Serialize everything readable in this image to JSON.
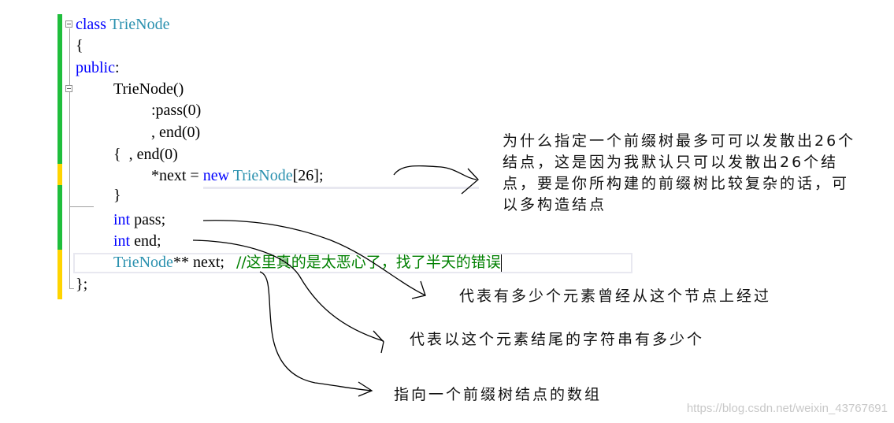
{
  "editor": {
    "gutter_colors": {
      "saved": "#1fbe3c",
      "modified": "#ffd400"
    },
    "code_lines": [
      {
        "text_kw": "class",
        "text_type": "TrieNode"
      },
      {
        "text": "{"
      },
      {
        "text_kw": "public",
        "text": ":"
      },
      {
        "text": "TrieNode()"
      },
      {
        "text": ":pass(0)"
      },
      {
        "text": ", end(0)"
      },
      {
        "text": "{  , end(0)"
      },
      {
        "text": "*next = ",
        "text_kw": "new",
        "text_type": "TrieNode",
        "text_tail": "[26];"
      },
      {
        "text": "}"
      },
      {
        "text_kw": "int",
        "text": " pass;"
      },
      {
        "text_kw": "int",
        "text": " end;"
      },
      {
        "text_type": "TrieNode",
        "text": "** next;",
        "comment": "//这里真的是太恶心了，找了半天的错误"
      },
      {
        "text": "};"
      }
    ]
  },
  "annotations": {
    "note_26": "为什么指定一个前缀树最多可可以发散出26个\n结点，这是因为我默认只可以发散出26个结\n点，要是你所构建的前缀树比较复杂的话，可\n以多构造结点",
    "note_pass": "代表有多少个元素曾经从这个节点上经过",
    "note_end": "代表以这个元素结尾的字符串有多少个",
    "note_next": "指向一个前缀树结点的数组"
  },
  "watermark": "https://blog.csdn.net/weixin_43767691"
}
